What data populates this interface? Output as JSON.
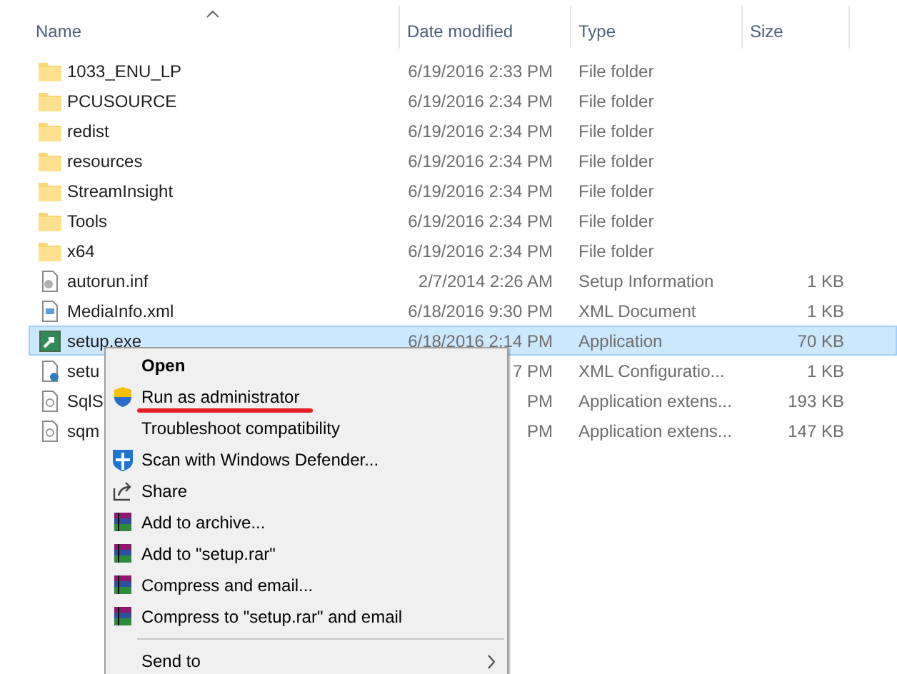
{
  "columns": [
    {
      "label": "Name",
      "sorted": true
    },
    {
      "label": "Date modified",
      "sorted": false
    },
    {
      "label": "Type",
      "sorted": false
    },
    {
      "label": "Size",
      "sorted": false
    }
  ],
  "files": [
    {
      "kind": "folder",
      "name": "1033_ENU_LP",
      "date": "6/19/2016 2:33 PM",
      "type": "File folder",
      "selected": false
    },
    {
      "kind": "folder",
      "name": "PCUSOURCE",
      "date": "6/19/2016 2:34 PM",
      "type": "File folder",
      "selected": false
    },
    {
      "kind": "folder",
      "name": "redist",
      "date": "6/19/2016 2:34 PM",
      "type": "File folder",
      "selected": false
    },
    {
      "kind": "folder",
      "name": "resources",
      "date": "6/19/2016 2:34 PM",
      "type": "File folder",
      "selected": false
    },
    {
      "kind": "folder",
      "name": "StreamInsight",
      "date": "6/19/2016 2:34 PM",
      "type": "File folder",
      "selected": false
    },
    {
      "kind": "folder",
      "name": "Tools",
      "date": "6/19/2016 2:34 PM",
      "type": "File folder",
      "selected": false
    },
    {
      "kind": "folder",
      "name": "x64",
      "date": "6/19/2016 2:34 PM",
      "type": "File folder",
      "selected": false
    },
    {
      "kind": "settings",
      "name": "autorun.inf",
      "date": "2/7/2014 2:26 AM",
      "type": "Setup Information",
      "size": "1 KB",
      "selected": false
    },
    {
      "kind": "xml",
      "name": "MediaInfo.xml",
      "date": "6/18/2016 9:30 PM",
      "type": "XML Document",
      "size": "1 KB",
      "selected": false
    },
    {
      "kind": "exe",
      "name": "setup.exe",
      "date": "6/18/2016 2:14 PM",
      "type": "Application",
      "size": "70 KB",
      "selected": true
    },
    {
      "kind": "config",
      "name": "setu",
      "date": "7 PM",
      "type": "XML Configuratio...",
      "size": "1 KB",
      "selected": false
    },
    {
      "kind": "dll",
      "name": "SqlS",
      "date": "PM",
      "type": "Application extens...",
      "size": "193 KB",
      "selected": false
    },
    {
      "kind": "dll",
      "name": "sqm",
      "date": "PM",
      "type": "Application extens...",
      "size": "147 KB",
      "selected": false
    }
  ],
  "context_menu": [
    {
      "kind": "plain",
      "label": "Open",
      "bold": true,
      "underlined": false
    },
    {
      "kind": "uac",
      "label": "Run as administrator",
      "bold": false,
      "underlined": true
    },
    {
      "kind": "plain",
      "label": "Troubleshoot compatibility",
      "bold": false,
      "underlined": false
    },
    {
      "kind": "defender",
      "label": "Scan with Windows Defender...",
      "bold": false,
      "underlined": false
    },
    {
      "kind": "share",
      "label": "Share",
      "bold": false,
      "underlined": false
    },
    {
      "kind": "archive",
      "label": "Add to archive...",
      "bold": false,
      "underlined": false
    },
    {
      "kind": "archive",
      "label": "Add to \"setup.rar\"",
      "bold": false,
      "underlined": false
    },
    {
      "kind": "archive",
      "label": "Compress and email...",
      "bold": false,
      "underlined": false
    },
    {
      "kind": "archive",
      "label": "Compress to \"setup.rar\" and email",
      "bold": false,
      "underlined": false
    },
    {
      "kind": "separator"
    },
    {
      "kind": "submenu",
      "label": "Send to",
      "bold": false,
      "underlined": false
    }
  ]
}
